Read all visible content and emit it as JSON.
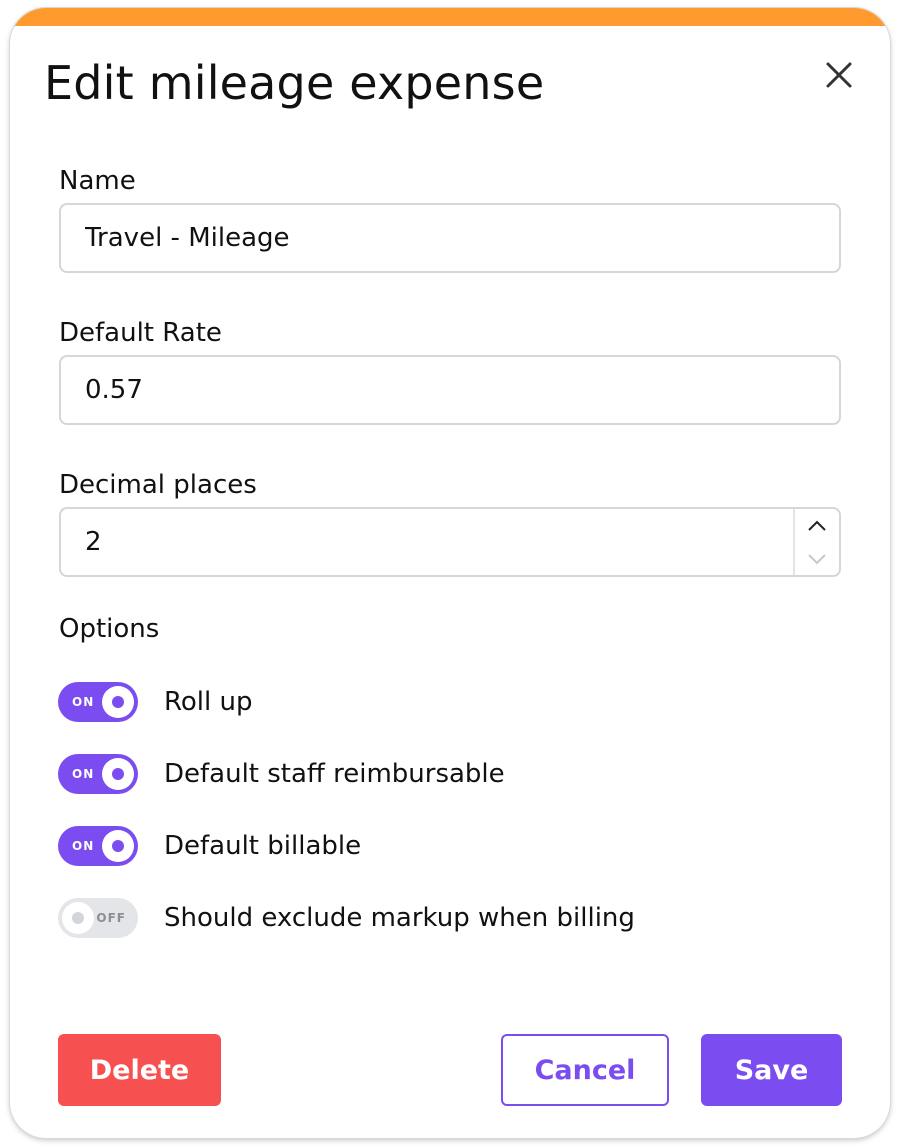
{
  "modal": {
    "title": "Edit mileage expense",
    "accent_color": "#ff9a2e",
    "close_icon": "close-icon"
  },
  "fields": {
    "name": {
      "label": "Name",
      "value": "Travel - Mileage"
    },
    "default_rate": {
      "label": "Default Rate",
      "value": "0.57"
    },
    "decimal_places": {
      "label": "Decimal places",
      "value": "2"
    }
  },
  "options": {
    "heading": "Options",
    "items": [
      {
        "label": "Roll up",
        "state": "ON",
        "enabled": true
      },
      {
        "label": "Default staff reimbursable",
        "state": "ON",
        "enabled": true
      },
      {
        "label": "Default billable",
        "state": "ON",
        "enabled": true
      },
      {
        "label": "Should exclude markup when billing",
        "state": "OFF",
        "enabled": false
      }
    ]
  },
  "actions": {
    "delete_label": "Delete",
    "cancel_label": "Cancel",
    "save_label": "Save"
  },
  "colors": {
    "primary": "#7b4cf0",
    "danger": "#f75050",
    "toggle_off": "#e3e5e8"
  }
}
